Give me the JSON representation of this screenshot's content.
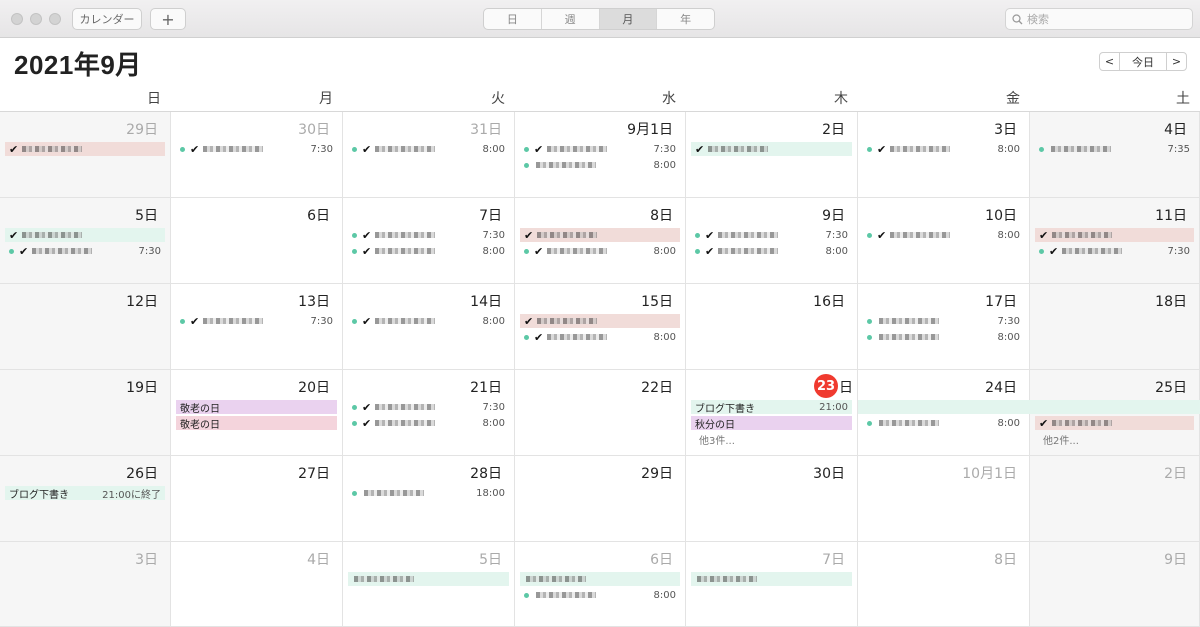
{
  "toolbar": {
    "calendars_label": "カレンダー",
    "add_label": "+",
    "views": [
      "日",
      "週",
      "月",
      "年"
    ],
    "active_view": "月",
    "search_placeholder": "検索"
  },
  "header": {
    "title": "2021年9月",
    "prev_label": "<",
    "today_label": "今日",
    "next_label": ">"
  },
  "weekdays": [
    "日",
    "月",
    "火",
    "水",
    "木",
    "金",
    "土"
  ],
  "colors": {
    "today": "#f03a2f",
    "holiday_purple": "#ead2ef",
    "holiday_rose": "#f4d4dc",
    "event_mint": "#e3f5ee",
    "event_pink": "#f1dcd9",
    "dot": "#5cc8a6"
  },
  "weeks": [
    {
      "days": [
        {
          "label": "29日",
          "dim": true,
          "events": [
            {
              "style": "bar pink",
              "check": true,
              "text": "",
              "time": ""
            }
          ]
        },
        {
          "label": "30日",
          "dim": true,
          "events": [
            {
              "style": "dot",
              "check": true,
              "text": "",
              "time": "7:30"
            }
          ]
        },
        {
          "label": "31日",
          "dim": true,
          "events": [
            {
              "style": "dot",
              "check": true,
              "text": "",
              "time": "8:00"
            }
          ]
        },
        {
          "label": "9月1日",
          "events": [
            {
              "style": "dot",
              "check": true,
              "text": "",
              "time": "7:30"
            },
            {
              "style": "dot",
              "check": false,
              "text": "",
              "time": "8:00"
            }
          ]
        },
        {
          "label": "2日",
          "events": [
            {
              "style": "bar mint",
              "check": true,
              "text": "",
              "time": ""
            }
          ]
        },
        {
          "label": "3日",
          "events": [
            {
              "style": "dot",
              "check": true,
              "text": "",
              "time": "8:00"
            }
          ]
        },
        {
          "label": "4日",
          "events": [
            {
              "style": "dot",
              "check": false,
              "text": "",
              "time": "7:35"
            }
          ]
        }
      ]
    },
    {
      "days": [
        {
          "label": "5日",
          "events": [
            {
              "style": "bar mint",
              "check": true,
              "text": "",
              "time": ""
            },
            {
              "style": "dot",
              "check": true,
              "text": "",
              "time": "7:30"
            }
          ]
        },
        {
          "label": "6日",
          "events": []
        },
        {
          "label": "7日",
          "events": [
            {
              "style": "dot",
              "check": true,
              "text": "",
              "time": "7:30"
            },
            {
              "style": "dot",
              "check": true,
              "text": "",
              "time": "8:00"
            }
          ]
        },
        {
          "label": "8日",
          "events": [
            {
              "style": "bar pink",
              "check": true,
              "text": "",
              "time": ""
            },
            {
              "style": "dot",
              "check": true,
              "text": "",
              "time": "8:00"
            }
          ]
        },
        {
          "label": "9日",
          "events": [
            {
              "style": "dot",
              "check": true,
              "text": "",
              "time": "7:30"
            },
            {
              "style": "dot",
              "check": true,
              "text": "",
              "time": "8:00"
            }
          ]
        },
        {
          "label": "10日",
          "events": [
            {
              "style": "dot",
              "check": true,
              "text": "",
              "time": "8:00"
            }
          ]
        },
        {
          "label": "11日",
          "events": [
            {
              "style": "bar pink",
              "check": true,
              "text": "",
              "time": ""
            },
            {
              "style": "dot",
              "check": true,
              "text": "",
              "time": "7:30"
            }
          ]
        }
      ]
    },
    {
      "days": [
        {
          "label": "12日",
          "events": []
        },
        {
          "label": "13日",
          "events": [
            {
              "style": "dot",
              "check": true,
              "text": "",
              "time": "7:30"
            }
          ]
        },
        {
          "label": "14日",
          "events": [
            {
              "style": "dot",
              "check": true,
              "text": "",
              "time": "8:00"
            }
          ]
        },
        {
          "label": "15日",
          "events": [
            {
              "style": "bar pink",
              "check": true,
              "text": "",
              "time": ""
            },
            {
              "style": "dot",
              "check": true,
              "text": "",
              "time": "8:00"
            }
          ]
        },
        {
          "label": "16日",
          "events": []
        },
        {
          "label": "17日",
          "events": [
            {
              "style": "dot",
              "check": false,
              "text": "",
              "time": "7:30"
            },
            {
              "style": "dot",
              "check": false,
              "text": "",
              "time": "8:00"
            }
          ]
        },
        {
          "label": "18日",
          "events": []
        }
      ]
    },
    {
      "days": [
        {
          "label": "19日",
          "events": []
        },
        {
          "label": "20日",
          "events": [
            {
              "style": "bar purple",
              "check": false,
              "text": "敬老の日",
              "time": ""
            },
            {
              "style": "bar rose",
              "check": false,
              "text": "敬老の日",
              "time": ""
            }
          ]
        },
        {
          "label": "21日",
          "events": [
            {
              "style": "dot",
              "check": true,
              "text": "",
              "time": "7:30"
            },
            {
              "style": "dot",
              "check": true,
              "text": "",
              "time": "8:00"
            }
          ]
        },
        {
          "label": "22日",
          "events": []
        },
        {
          "label": "23",
          "today": true,
          "suffix": "日",
          "events": [
            {
              "style": "span mint",
              "check": false,
              "text": "ブログ下書き",
              "time": "21:00"
            },
            {
              "style": "bar purple",
              "check": false,
              "text": "秋分の日",
              "time": ""
            }
          ],
          "more": "他3件..."
        },
        {
          "label": "24日",
          "events": [
            {
              "style": "spacer",
              "check": false,
              "text": "",
              "time": ""
            },
            {
              "style": "dot",
              "check": false,
              "text": "",
              "time": "8:00"
            }
          ]
        },
        {
          "label": "25日",
          "events": [
            {
              "style": "spacer",
              "check": false,
              "text": "",
              "time": ""
            },
            {
              "style": "bar pink",
              "check": true,
              "text": "",
              "time": ""
            }
          ],
          "more": "他2件..."
        }
      ]
    },
    {
      "days": [
        {
          "label": "26日",
          "events": [
            {
              "style": "bar mint",
              "check": false,
              "text": "ブログ下書き",
              "time": "21:00に終了"
            }
          ]
        },
        {
          "label": "27日",
          "events": []
        },
        {
          "label": "28日",
          "events": [
            {
              "style": "dot",
              "check": false,
              "text": "",
              "time": "18:00"
            }
          ]
        },
        {
          "label": "29日",
          "events": []
        },
        {
          "label": "30日",
          "events": []
        },
        {
          "label": "10月1日",
          "dim": true,
          "events": []
        },
        {
          "label": "2日",
          "dim": true,
          "events": []
        }
      ]
    },
    {
      "days": [
        {
          "label": "3日",
          "dim": true,
          "events": []
        },
        {
          "label": "4日",
          "dim": true,
          "events": []
        },
        {
          "label": "5日",
          "dim": true,
          "events": [
            {
              "style": "bar mint",
              "check": false,
              "text": "",
              "time": ""
            }
          ]
        },
        {
          "label": "6日",
          "dim": true,
          "events": [
            {
              "style": "bar mint",
              "check": false,
              "text": "",
              "time": ""
            },
            {
              "style": "dot",
              "check": false,
              "text": "",
              "time": "8:00"
            }
          ]
        },
        {
          "label": "7日",
          "dim": true,
          "events": [
            {
              "style": "bar mint",
              "check": false,
              "text": "",
              "time": ""
            }
          ]
        },
        {
          "label": "8日",
          "dim": true,
          "events": []
        },
        {
          "label": "9日",
          "dim": true,
          "events": []
        }
      ]
    }
  ]
}
